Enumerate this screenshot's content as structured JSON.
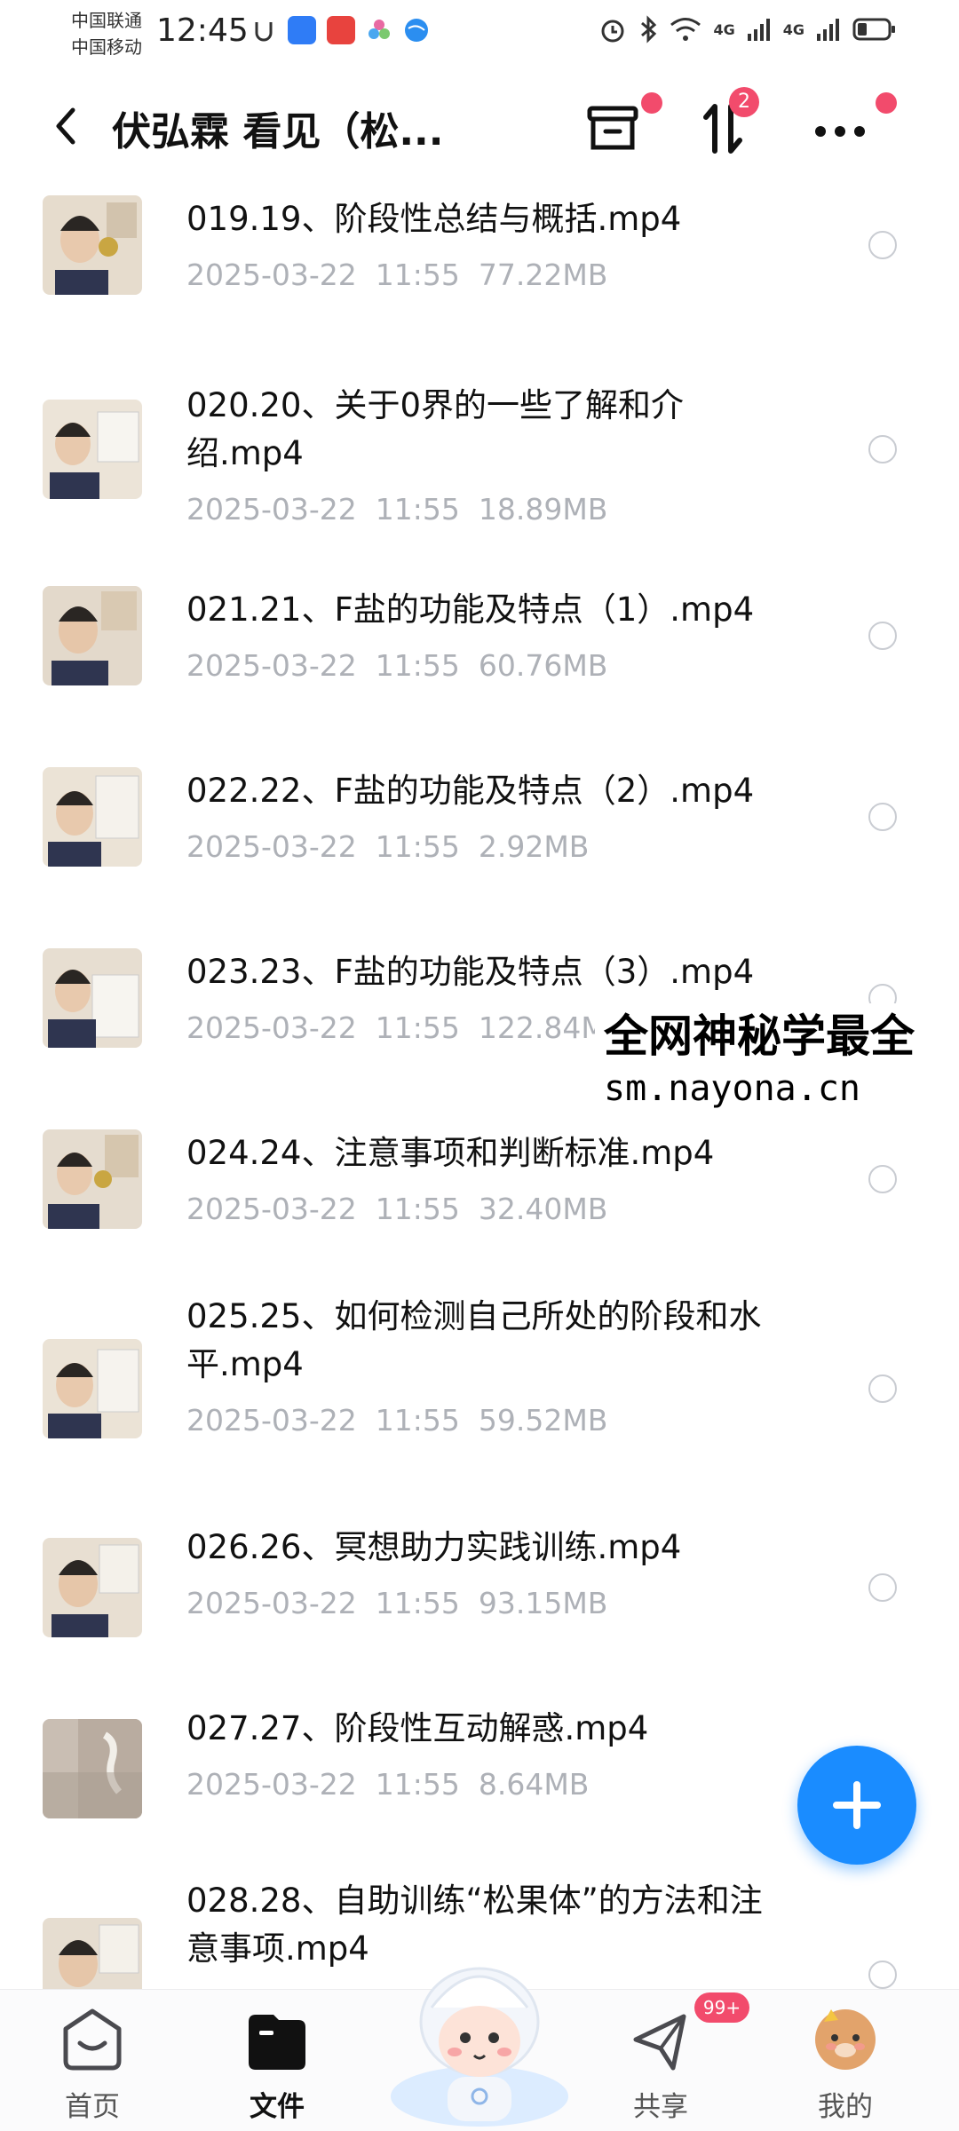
{
  "status_bar": {
    "carrier_1": "中国联通",
    "carrier_2": "中国移动",
    "time": "12:45",
    "network_1": "4G",
    "network_2": "4G"
  },
  "header": {
    "title": "伏弘霖 看见（松...",
    "sort_badge": "2"
  },
  "files": [
    {
      "name": "019.19、阶段性总结与概括.mp4",
      "date": "2025-03-22",
      "time": "11:55",
      "size": "77.22MB"
    },
    {
      "name": "020.20、关于0界的一些了解和介绍.mp4",
      "date": "2025-03-22",
      "time": "11:55",
      "size": "18.89MB"
    },
    {
      "name": "021.21、F盐的功能及特点（1）.mp4",
      "date": "2025-03-22",
      "time": "11:55",
      "size": "60.76MB"
    },
    {
      "name": "022.22、F盐的功能及特点（2）.mp4",
      "date": "2025-03-22",
      "time": "11:55",
      "size": "2.92MB"
    },
    {
      "name": "023.23、F盐的功能及特点（3）.mp4",
      "date": "2025-03-22",
      "time": "11:55",
      "size": "122.84MB"
    },
    {
      "name": "024.24、注意事项和判断标准.mp4",
      "date": "2025-03-22",
      "time": "11:55",
      "size": "32.40MB"
    },
    {
      "name": "025.25、如何检测自己所处的阶段和水平.mp4",
      "date": "2025-03-22",
      "time": "11:55",
      "size": "59.52MB"
    },
    {
      "name": "026.26、冥想助力实践训练.mp4",
      "date": "2025-03-22",
      "time": "11:55",
      "size": "93.15MB"
    },
    {
      "name": "027.27、阶段性互动解惑.mp4",
      "date": "2025-03-22",
      "time": "11:55",
      "size": "8.64MB"
    },
    {
      "name": "028.28、自助训练“松果体”的方法和注意事项.mp4",
      "date": "",
      "time": "",
      "size": ""
    }
  ],
  "watermark": {
    "line1": "全网神秘学最全",
    "line2": "sm.nayona.cn"
  },
  "bottom_nav": {
    "home": "首页",
    "files": "文件",
    "share": "共享",
    "mine": "我的",
    "share_badge": "99+"
  },
  "colors": {
    "accent": "#1a8cff",
    "badge": "#f24b6c",
    "meta_text": "#aeb1b7"
  }
}
